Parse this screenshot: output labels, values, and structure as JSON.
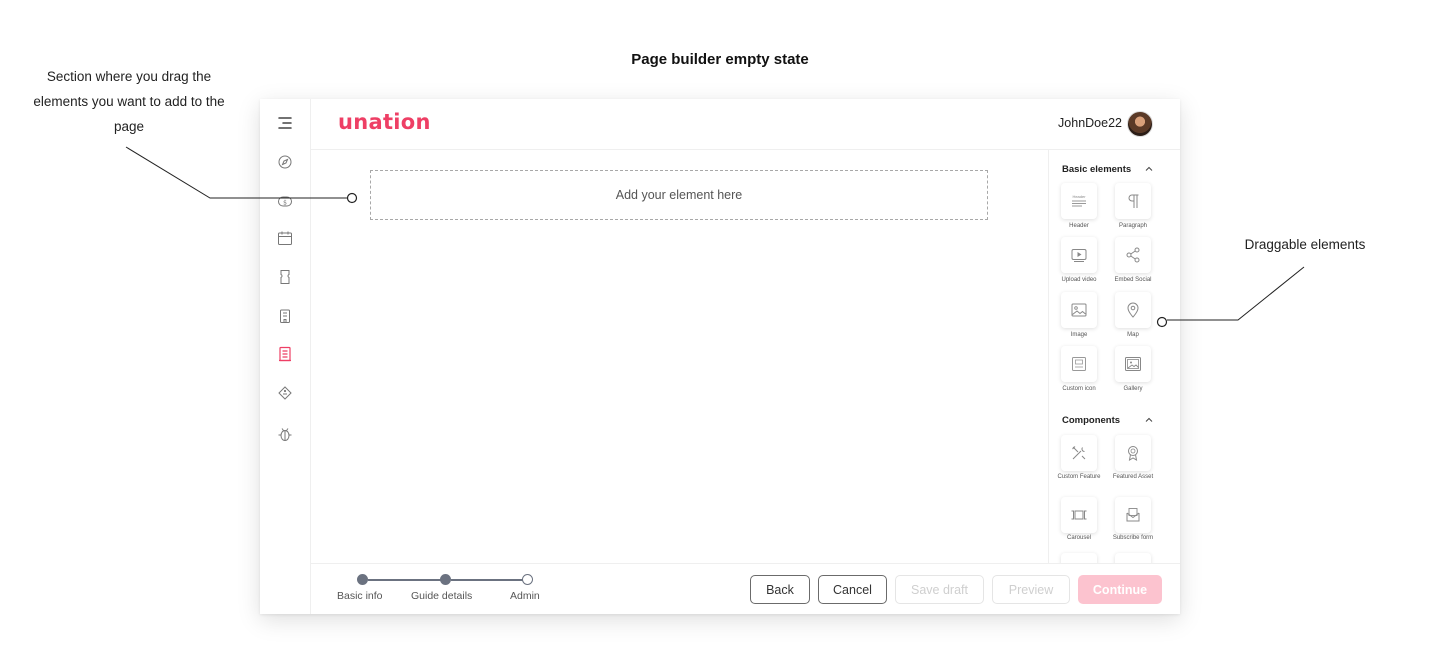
{
  "annotations": {
    "title": "Page builder empty state",
    "left_note": "Section where you drag the elements you want to add to the page",
    "right_note": "Draggable elements"
  },
  "header": {
    "logo": "unation",
    "username": "JohnDoe22"
  },
  "sidebar": {
    "items": [
      {
        "icon": "menu-icon"
      },
      {
        "icon": "compass-icon"
      },
      {
        "icon": "money-icon"
      },
      {
        "icon": "calendar-icon"
      },
      {
        "icon": "ticket-icon"
      },
      {
        "icon": "building-icon"
      },
      {
        "icon": "guide-icon",
        "active": true
      },
      {
        "icon": "tag-icon"
      },
      {
        "icon": "bug-icon"
      }
    ],
    "active_color": "#ee3f65"
  },
  "canvas": {
    "dropzone_label": "Add your element here"
  },
  "panel": {
    "basic_title": "Basic elements",
    "basic": [
      {
        "label": "Header",
        "icon": "header-icon"
      },
      {
        "label": "Paragraph",
        "icon": "paragraph-icon"
      },
      {
        "label": "Upload video",
        "icon": "video-icon"
      },
      {
        "label": "Embed Social",
        "icon": "share-icon"
      },
      {
        "label": "Image",
        "icon": "image-icon"
      },
      {
        "label": "Map",
        "icon": "map-pin-icon"
      },
      {
        "label": "Custom icon",
        "icon": "custom-icon-icon"
      },
      {
        "label": "Gallery",
        "icon": "gallery-icon"
      }
    ],
    "components_title": "Components",
    "components": [
      {
        "label": "Custom Feature",
        "icon": "tools-icon"
      },
      {
        "label": "Featured Asset",
        "icon": "award-icon"
      },
      {
        "label": "Carousel",
        "icon": "carousel-icon"
      },
      {
        "label": "Subscribe form",
        "icon": "subscribe-icon"
      }
    ]
  },
  "stepper": {
    "steps": [
      {
        "label": "Basic info",
        "state": "done"
      },
      {
        "label": "Guide details",
        "state": "done"
      },
      {
        "label": "Admin",
        "state": "todo"
      }
    ]
  },
  "actions": {
    "back": "Back",
    "cancel": "Cancel",
    "save_draft": "Save draft",
    "preview": "Preview",
    "continue": "Continue"
  },
  "colors": {
    "brand": "#ee3f65",
    "continue_bg": "#fcc3cf"
  }
}
